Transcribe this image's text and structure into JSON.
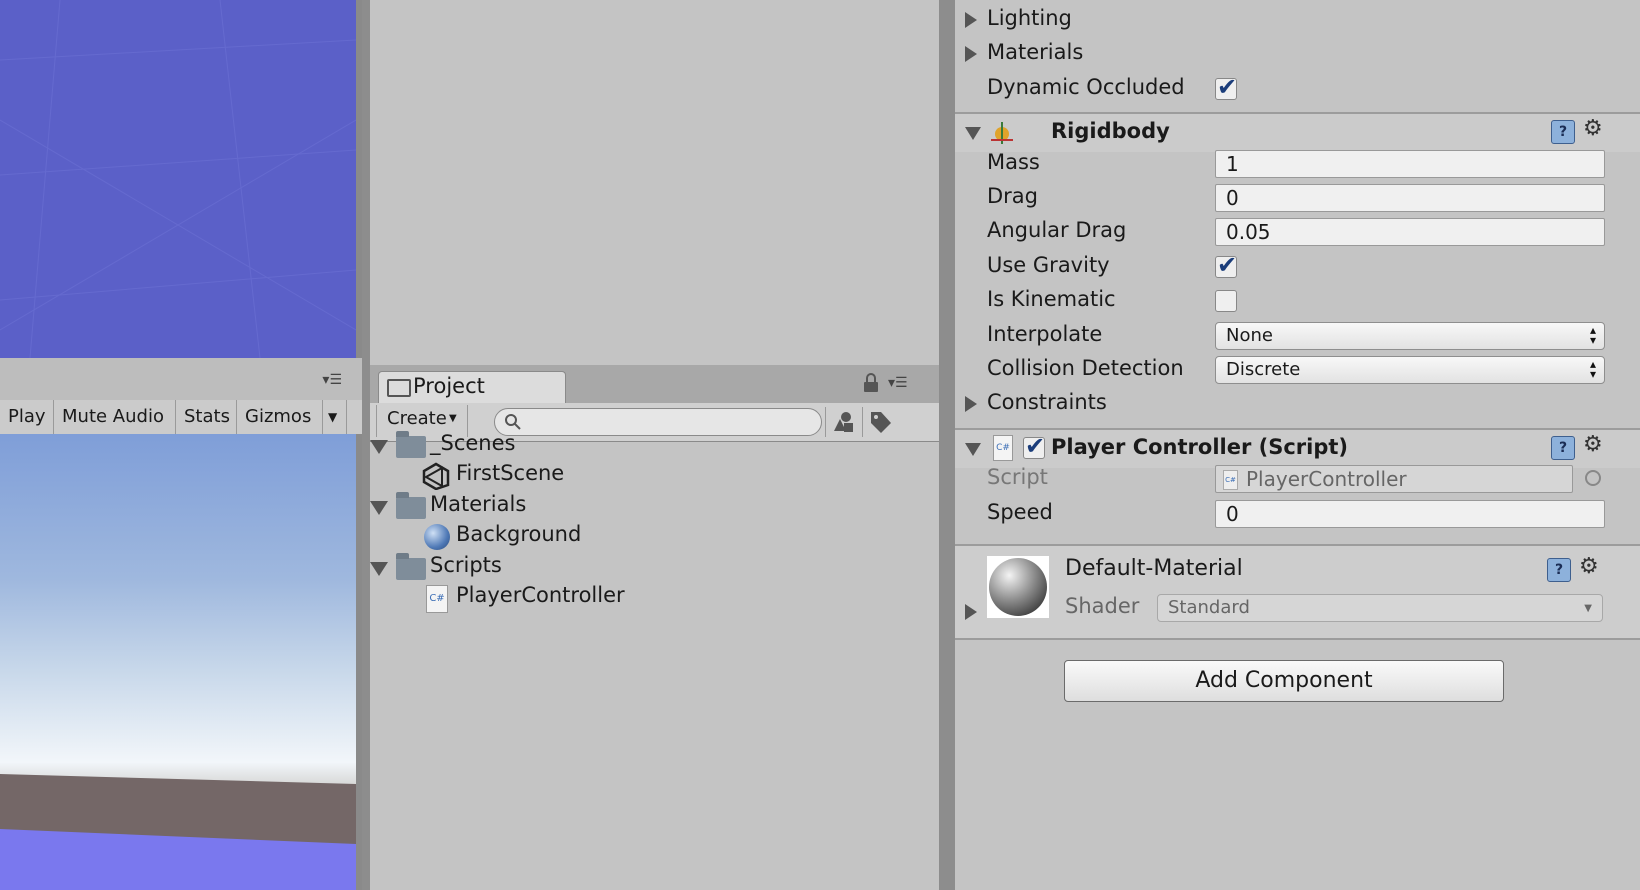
{
  "game_toolbar": {
    "play_label": "Play",
    "mute_audio_label": "Mute Audio",
    "stats_label": "Stats",
    "gizmos_label": "Gizmos"
  },
  "project": {
    "tab_label": "Project",
    "create_label": "Create",
    "search_placeholder": "",
    "tree": [
      {
        "label": "_Scenes",
        "type": "folder",
        "icon": "folder-icon"
      },
      {
        "label": "FirstScene",
        "type": "scene",
        "icon": "unity-scene-icon"
      },
      {
        "label": "Materials",
        "type": "folder",
        "icon": "folder-icon"
      },
      {
        "label": "Background",
        "type": "material",
        "icon": "sphere-material-icon"
      },
      {
        "label": "Scripts",
        "type": "folder",
        "icon": "folder-icon"
      },
      {
        "label": "PlayerController",
        "type": "script",
        "icon": "csharp-script-icon"
      }
    ]
  },
  "inspector": {
    "renderer": {
      "lighting_label": "Lighting",
      "materials_label": "Materials",
      "dynamic_occluded_label": "Dynamic Occluded",
      "dynamic_occluded_checked": true
    },
    "rigidbody": {
      "title": "Rigidbody",
      "mass_label": "Mass",
      "mass_value": "1",
      "drag_label": "Drag",
      "drag_value": "0",
      "angular_drag_label": "Angular Drag",
      "angular_drag_value": "0.05",
      "use_gravity_label": "Use Gravity",
      "use_gravity_checked": true,
      "is_kinematic_label": "Is Kinematic",
      "is_kinematic_checked": false,
      "interpolate_label": "Interpolate",
      "interpolate_value": "None",
      "collision_detection_label": "Collision Detection",
      "collision_detection_value": "Discrete",
      "constraints_label": "Constraints"
    },
    "player_controller": {
      "title": "Player Controller (Script)",
      "enabled": true,
      "script_label": "Script",
      "script_value": "PlayerController",
      "speed_label": "Speed",
      "speed_value": "0"
    },
    "material": {
      "name": "Default-Material",
      "shader_label": "Shader",
      "shader_value": "Standard"
    },
    "add_component_label": "Add Component"
  },
  "colors": {
    "scene_view": "#5b60c8",
    "panel_bg": "#c4c4c4",
    "checkmark": "#1b3d7a"
  }
}
